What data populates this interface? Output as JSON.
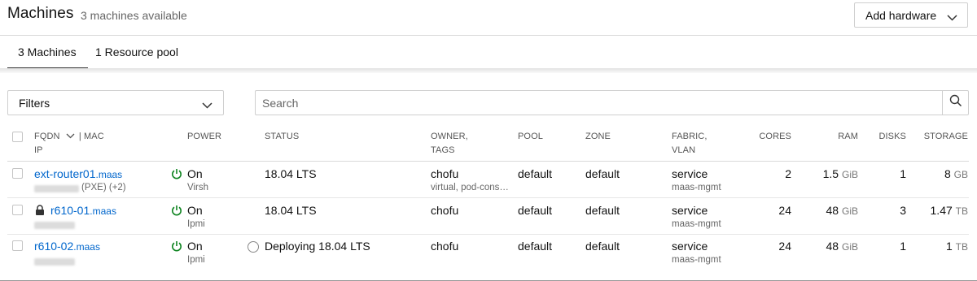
{
  "header": {
    "title": "Machines",
    "subtitle": "3 machines available",
    "add_hardware": "Add hardware",
    "chevron_icon": "chevron-down-icon"
  },
  "tabs": [
    {
      "label": "3 Machines",
      "active": true
    },
    {
      "label": "1 Resource pool",
      "active": false
    }
  ],
  "filters": {
    "label": "Filters"
  },
  "search": {
    "placeholder": "Search",
    "value": "",
    "icon": "search-icon"
  },
  "columns": {
    "fqdn": "FQDN",
    "mac": "| MAC",
    "ip": "IP",
    "power": "POWER",
    "status": "STATUS",
    "owner": "OWNER,",
    "tags": "TAGS",
    "pool": "POOL",
    "zone": "ZONE",
    "fabric": "FABRIC,",
    "vlan": "VLAN",
    "cores": "CORES",
    "ram": "RAM",
    "disks": "DISKS",
    "storage": "STORAGE"
  },
  "machines": [
    {
      "hostname": "ext-router01",
      "domain": ".maas",
      "ip_suffix": "(PXE) (+2)",
      "locked": false,
      "power": "On",
      "power_type": "Virsh",
      "status": "18.04 LTS",
      "deploying": false,
      "owner": "chofu",
      "tags": "virtual, pod-cons…",
      "pool": "default",
      "zone": "default",
      "fabric": "service",
      "vlan": "maas-mgmt",
      "cores": "2",
      "ram": "1.5",
      "ram_unit": "GiB",
      "disks": "1",
      "storage": "8",
      "storage_unit": "GB"
    },
    {
      "hostname": "r610-01",
      "domain": ".maas",
      "ip_suffix": "",
      "locked": true,
      "power": "On",
      "power_type": "Ipmi",
      "status": "18.04 LTS",
      "deploying": false,
      "owner": "chofu",
      "tags": "",
      "pool": "default",
      "zone": "default",
      "fabric": "service",
      "vlan": "maas-mgmt",
      "cores": "24",
      "ram": "48",
      "ram_unit": "GiB",
      "disks": "3",
      "storage": "1.47",
      "storage_unit": "TB"
    },
    {
      "hostname": "r610-02",
      "domain": ".maas",
      "ip_suffix": "",
      "locked": false,
      "power": "On",
      "power_type": "Ipmi",
      "status": "Deploying 18.04 LTS",
      "deploying": true,
      "owner": "chofu",
      "tags": "",
      "pool": "default",
      "zone": "default",
      "fabric": "service",
      "vlan": "maas-mgmt",
      "cores": "24",
      "ram": "48",
      "ram_unit": "GiB",
      "disks": "1",
      "storage": "1",
      "storage_unit": "TB"
    }
  ],
  "colors": {
    "link": "#0066cc",
    "power_on": "#0e8420"
  }
}
